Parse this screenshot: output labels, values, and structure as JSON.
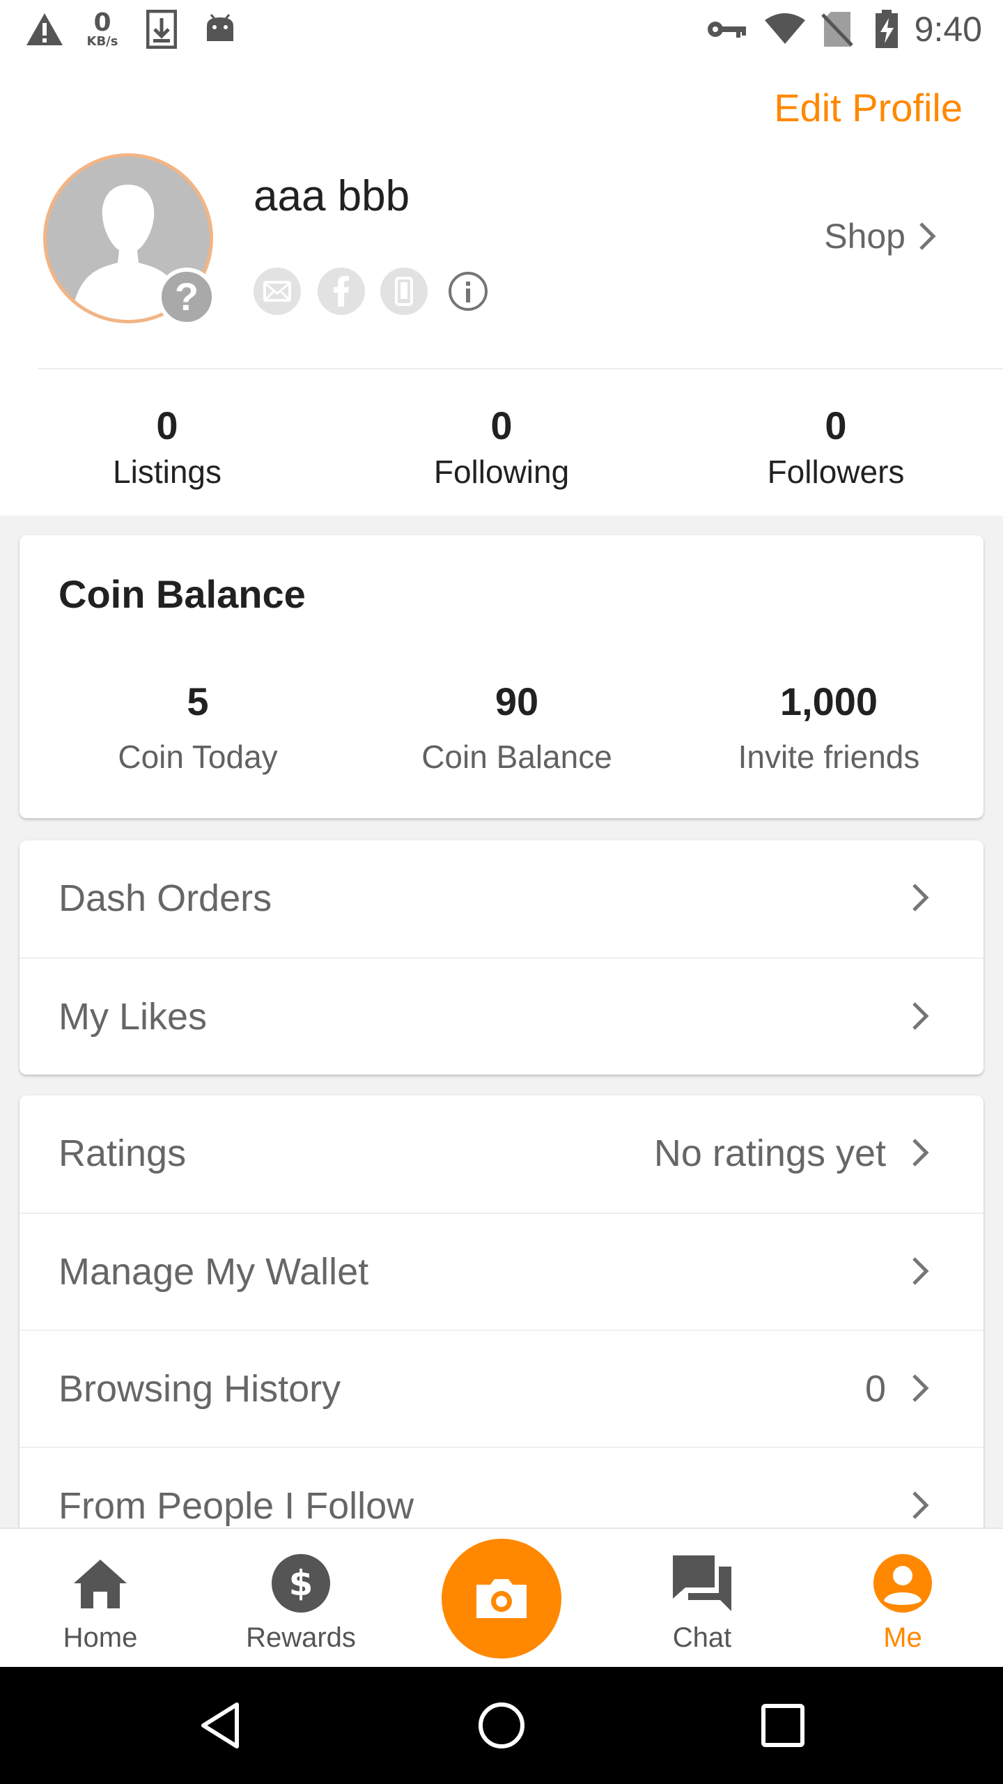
{
  "status_bar": {
    "net_speed_value": "0",
    "net_speed_unit": "KB/s",
    "time": "9:40",
    "icons": [
      "warning-icon",
      "download-icon",
      "android-icon",
      "key-icon",
      "wifi-icon",
      "no-sim-icon",
      "battery-charging-icon"
    ]
  },
  "profile": {
    "edit_label": "Edit Profile",
    "user_name": "aaa bbb",
    "shop_label": "Shop",
    "verification_icons": [
      "email-icon",
      "facebook-icon",
      "phone-icon",
      "info-icon"
    ],
    "avatar_badge": "?"
  },
  "stats": [
    {
      "value": "0",
      "label": "Listings"
    },
    {
      "value": "0",
      "label": "Following"
    },
    {
      "value": "0",
      "label": "Followers"
    }
  ],
  "coin_card": {
    "title": "Coin Balance",
    "items": [
      {
        "value": "5",
        "label": "Coin Today"
      },
      {
        "value": "90",
        "label": "Coin Balance"
      },
      {
        "value": "1,000",
        "label": "Invite friends"
      }
    ]
  },
  "orders_menu": [
    {
      "label": "Dash Orders",
      "value": ""
    },
    {
      "label": "My Likes",
      "value": ""
    }
  ],
  "account_menu": [
    {
      "label": "Ratings",
      "value": "No ratings yet"
    },
    {
      "label": "Manage My Wallet",
      "value": ""
    },
    {
      "label": "Browsing History",
      "value": "0"
    },
    {
      "label": "From People I Follow",
      "value": ""
    }
  ],
  "bottom_nav": {
    "items": [
      {
        "label": "Home",
        "icon": "home-icon"
      },
      {
        "label": "Rewards",
        "icon": "dollar-coin-icon"
      },
      {
        "label": "Chat",
        "icon": "chat-icon"
      },
      {
        "label": "Me",
        "icon": "profile-icon"
      }
    ],
    "center_icon": "camera-icon",
    "active": "Me"
  },
  "colors": {
    "accent": "#ff8800",
    "text_primary": "#212121",
    "text_secondary": "#666666",
    "background": "#f2f2f2"
  }
}
